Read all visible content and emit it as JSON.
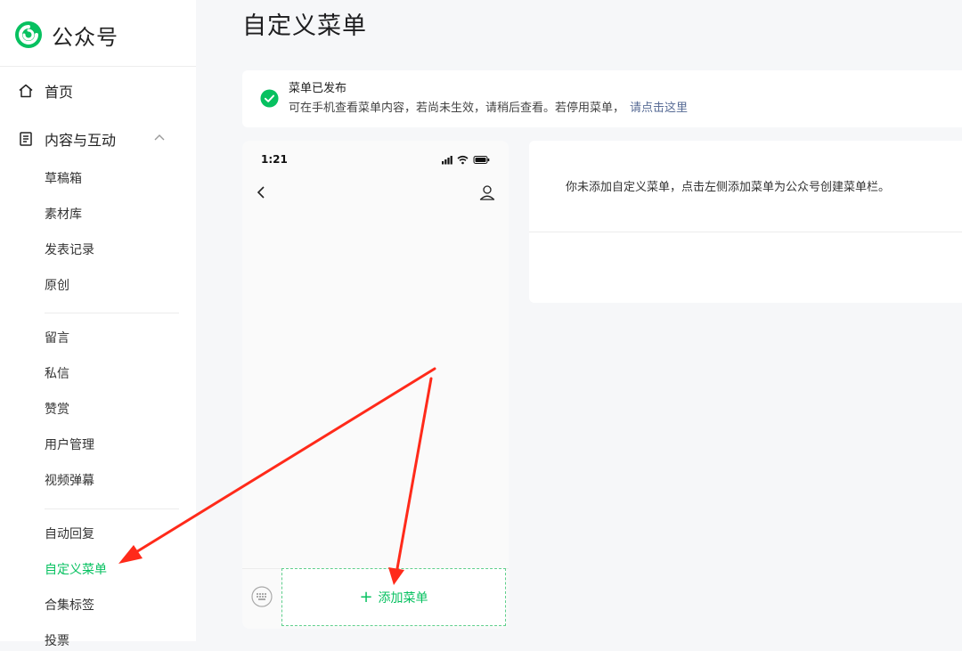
{
  "brand": {
    "name": "公众号",
    "logo_icon": "wechat-official-account-logo-icon",
    "color": "#07c160"
  },
  "sidebar": {
    "home": {
      "label": "首页",
      "icon": "home-icon"
    },
    "content": {
      "label": "内容与互动",
      "icon": "document-icon",
      "expanded": true,
      "groups": [
        [
          "草稿箱",
          "素材库",
          "发表记录",
          "原创"
        ],
        [
          "留言",
          "私信",
          "赞赏",
          "用户管理",
          "视频弹幕"
        ],
        [
          "自动回复",
          "自定义菜单",
          "合集标签",
          "投票"
        ]
      ],
      "active_item": "自定义菜单"
    }
  },
  "page": {
    "title": "自定义菜单"
  },
  "notice": {
    "icon": "success-check-icon",
    "title": "菜单已发布",
    "desc": "可在手机查看菜单内容，若尚未生效，请稍后查看。若停用菜单，",
    "link": "请点击这里"
  },
  "phone": {
    "time": "1:21",
    "status_icons": [
      "signal-icon",
      "wifi-icon",
      "battery-icon"
    ],
    "back_icon": "chevron-left-icon",
    "profile_icon": "person-icon",
    "keyboard_icon": "keyboard-icon",
    "add_menu": {
      "plus": "+",
      "label": "添加菜单"
    }
  },
  "info": {
    "text": "你未添加自定义菜单，点击左侧添加菜单为公众号创建菜单栏。"
  },
  "colors": {
    "accent": "#07c160",
    "link": "#576b95",
    "annotation_arrow": "#ff2a1a"
  }
}
